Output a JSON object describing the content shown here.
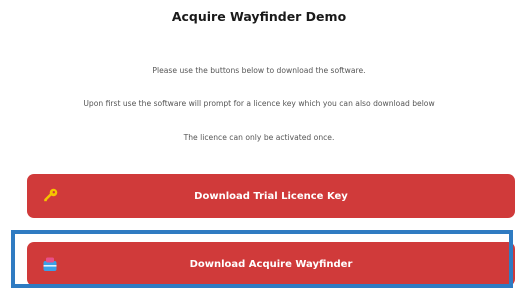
{
  "page": {
    "title": "Acquire Wayfinder Demo",
    "instructions": [
      "Please use the buttons below to download the software.",
      "Upon first use the software will prompt for a licence key which you can also download below",
      "The licence can only be activated once."
    ]
  },
  "buttons": {
    "trial_key_label": "Download Trial Licence Key",
    "trial_key_icon": "key-icon",
    "download_label": "Download Acquire Wayfinder",
    "download_icon": "package-icon"
  },
  "colors": {
    "button_bg": "#d03a3a",
    "highlight": "#2f7bc2"
  }
}
